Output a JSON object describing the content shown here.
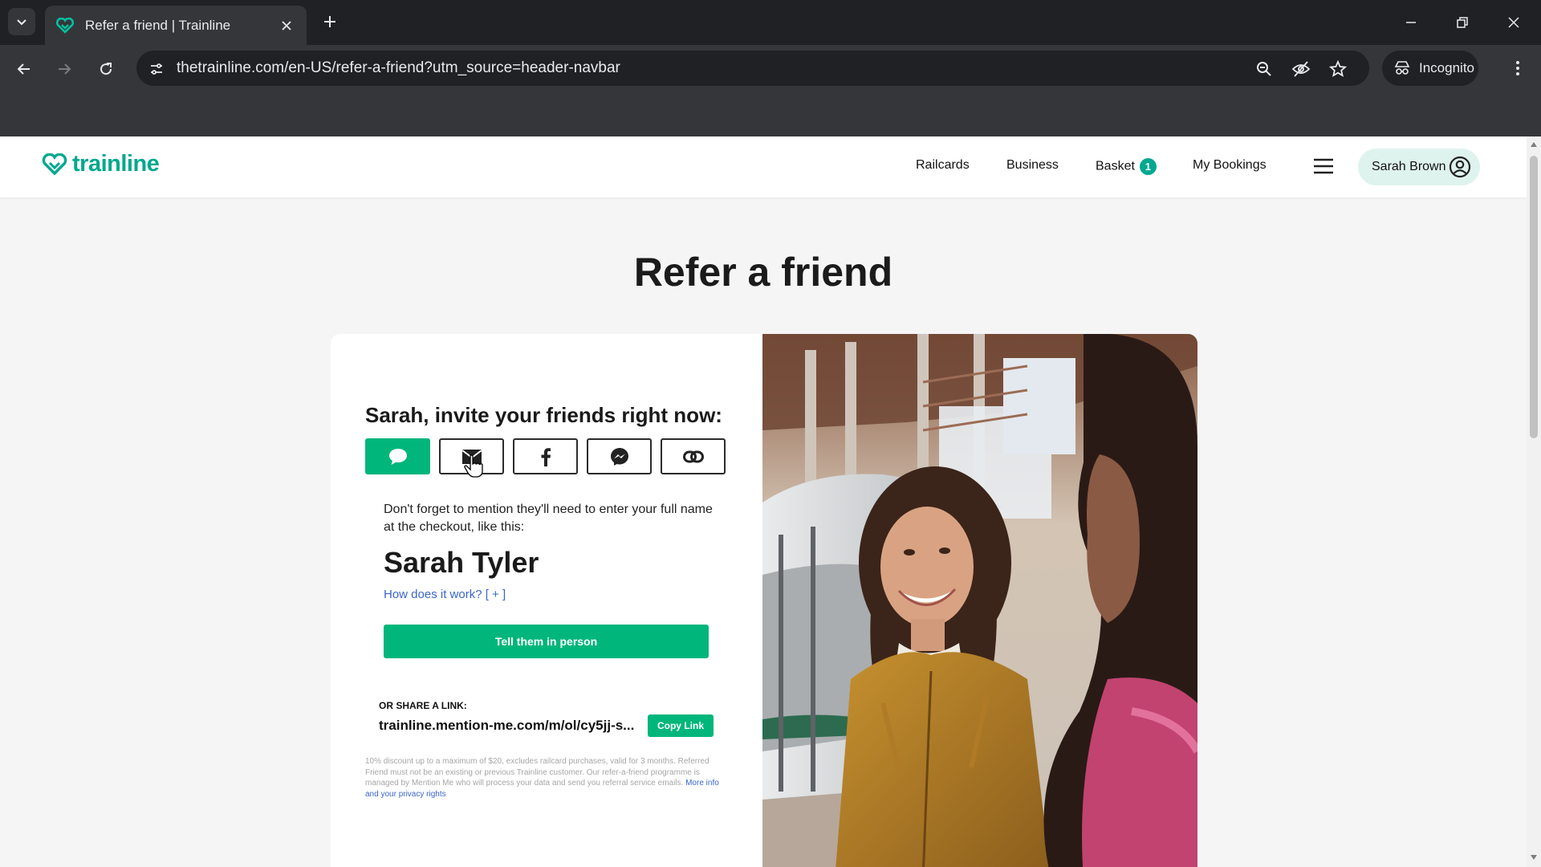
{
  "browser": {
    "tab_title": "Refer a friend | Trainline",
    "url": "thetrainline.com/en-US/refer-a-friend?utm_source=header-navbar",
    "incognito_label": "Incognito"
  },
  "header": {
    "logo_text": "trainline",
    "nav": {
      "railcards": "Railcards",
      "business": "Business",
      "basket": "Basket",
      "basket_count": "1",
      "my_bookings": "My Bookings"
    },
    "account_name": "Sarah Brown"
  },
  "main": {
    "page_title": "Refer a friend",
    "invite_heading": "Sarah, invite your friends right now:",
    "share_options": [
      "sms-icon",
      "email-icon",
      "facebook-icon",
      "messenger-icon",
      "link-icon"
    ],
    "mention_text": "Don't forget to mention they'll need to enter your full name at the checkout, like this:",
    "friend_name": "Sarah Tyler",
    "how_link": "How does it work? [ + ]",
    "tell_button": "Tell them in person",
    "share_link_label": "OR SHARE A LINK:",
    "share_link_url": "trainline.mention-me.com/m/ol/cy5jj-s...",
    "copy_button": "Copy Link",
    "fineprint": "10% discount up to a maximum of $20, excludes railcard purchases, valid for 3 months. Referred Friend must not be an existing or previous Trainline customer. Our refer-a-friend programme is managed by Mention Me who will process your data and send you referral service emails.",
    "fineprint_link": "More info and your privacy rights"
  },
  "colors": {
    "brand": "#00a88f",
    "button_green": "#00b67a",
    "link_blue": "#3a66c8"
  }
}
